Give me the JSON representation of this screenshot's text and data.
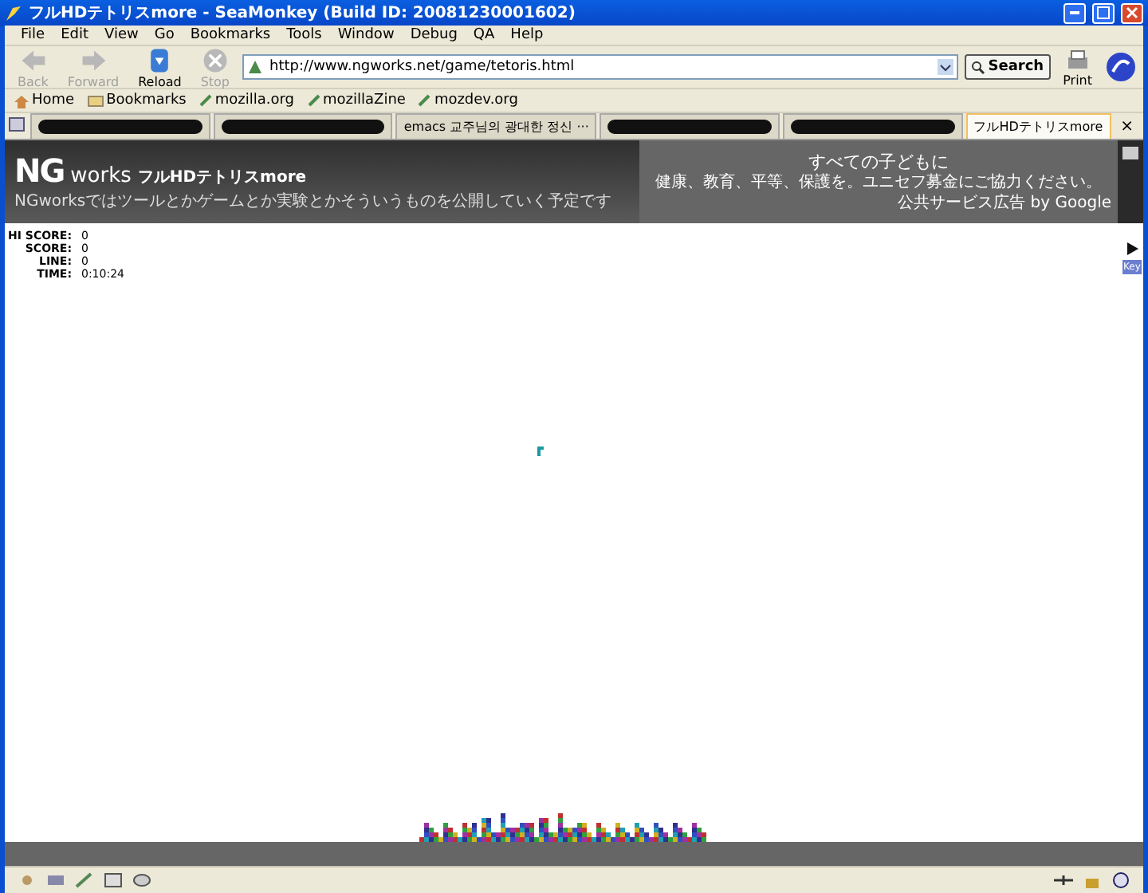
{
  "window": {
    "title": "フルHDテトリスmore - SeaMonkey (Build ID: 20081230001602)"
  },
  "menu": [
    "File",
    "Edit",
    "View",
    "Go",
    "Bookmarks",
    "Tools",
    "Window",
    "Debug",
    "QA",
    "Help"
  ],
  "nav_buttons": [
    {
      "label": "Back",
      "kind": "back",
      "disabled": true
    },
    {
      "label": "Forward",
      "kind": "forward",
      "disabled": true
    },
    {
      "label": "Reload",
      "kind": "reload",
      "disabled": false
    },
    {
      "label": "Stop",
      "kind": "stop",
      "disabled": true
    }
  ],
  "url": "http://www.ngworks.net/game/tetoris.html",
  "search_button": "Search",
  "print_button": "Print",
  "bookmarks": [
    {
      "label": "Home",
      "kind": "home"
    },
    {
      "label": "Bookmarks",
      "kind": "folder"
    },
    {
      "label": "mozilla.org",
      "kind": "link"
    },
    {
      "label": "mozillaZine",
      "kind": "link"
    },
    {
      "label": "mozdev.org",
      "kind": "link"
    }
  ],
  "tabs": [
    {
      "kind": "redacted",
      "selected": false
    },
    {
      "kind": "redacted",
      "selected": false
    },
    {
      "kind": "text",
      "label": "emacs 교주님의 광대한 정신 ···",
      "selected": false
    },
    {
      "kind": "redacted",
      "selected": false
    },
    {
      "kind": "redacted",
      "selected": false
    },
    {
      "kind": "text",
      "label": "フルHDテトリスmore",
      "selected": true
    }
  ],
  "tab_close": "×",
  "page": {
    "logo": "NG",
    "logo_suffix": "works",
    "title": "フルHDテトリスmore",
    "tagline": "NGworksではツールとかゲームとか実験とかそういうものを公開していく予定です",
    "ad": {
      "headline": "すべての子どもに",
      "body": "健康、教育、平等、保護を。ユニセフ募金にご協力ください。",
      "attribution": "公共サービス広告 by Google"
    },
    "stats": [
      {
        "label": "HI SCORE:",
        "value": "0"
      },
      {
        "label": "SCORE:",
        "value": "0"
      },
      {
        "label": "LINE:",
        "value": "0"
      },
      {
        "label": "TIME:",
        "value": "0:10:24"
      }
    ],
    "key_label": "Key"
  }
}
